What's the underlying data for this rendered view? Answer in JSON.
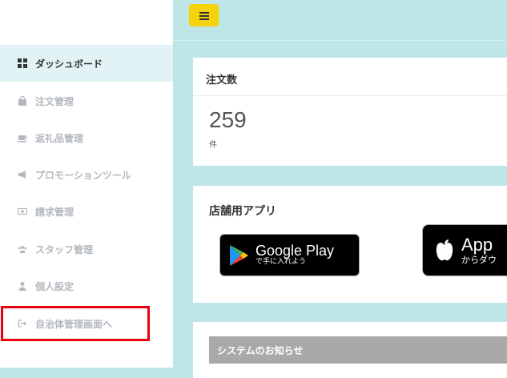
{
  "sidebar": {
    "items": [
      {
        "label": "ダッシュボード",
        "icon": "dashboard-icon"
      },
      {
        "label": "注文管理",
        "icon": "shopping-bag-icon"
      },
      {
        "label": "返礼品管理",
        "icon": "coffee-cup-icon"
      },
      {
        "label": "プロモーションツール",
        "icon": "megaphone-icon"
      },
      {
        "label": "請求管理",
        "icon": "money-bill-icon"
      },
      {
        "label": "スタッフ管理",
        "icon": "users-icon"
      },
      {
        "label": "個人設定",
        "icon": "user-icon"
      },
      {
        "label": "自治体管理画面へ",
        "icon": "sign-out-icon"
      }
    ]
  },
  "header": {
    "menu_icon": "hamburger-icon"
  },
  "orders_card": {
    "title": "注文数",
    "count": "259",
    "unit": "件"
  },
  "apps_card": {
    "title": "店舗用アプリ",
    "google_play": {
      "big": "Google Play",
      "small": "で手に入れよう"
    },
    "app_store": {
      "big": "App",
      "small": "からダウ"
    }
  },
  "notice_card": {
    "title": "システムのお知らせ"
  },
  "colors": {
    "accent": "#f6d20b",
    "background": "#bfe6e7",
    "highlight": "#e8000e"
  }
}
